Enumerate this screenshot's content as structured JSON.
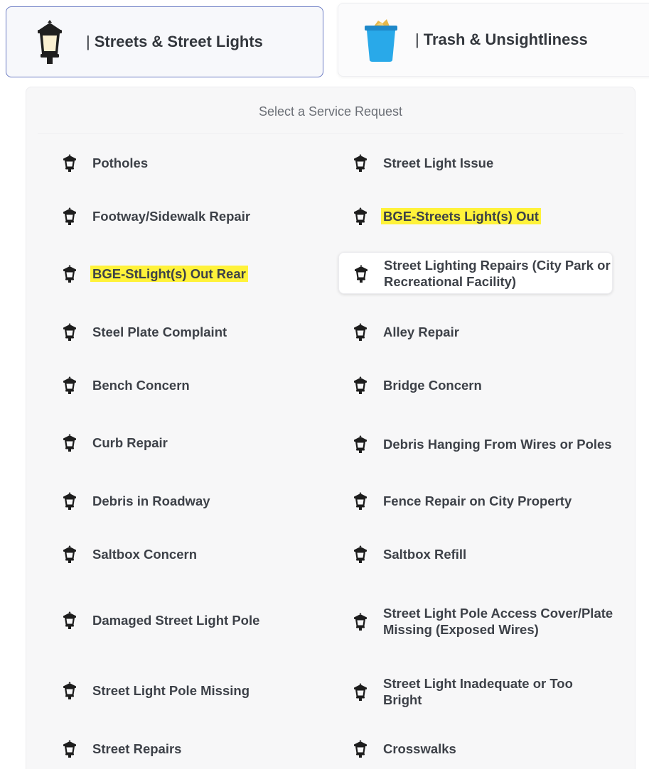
{
  "tabs": [
    {
      "label": "Streets & Street Lights",
      "icon": "street-lamp-icon",
      "selected": true
    },
    {
      "label": "Trash & Unsightliness",
      "icon": "trash-can-icon",
      "selected": false
    }
  ],
  "panel": {
    "title": "Select a Service Request",
    "items": [
      {
        "label": "Potholes",
        "highlighted": false
      },
      {
        "label": "Street Light Issue",
        "highlighted": false
      },
      {
        "label": "Footway/Sidewalk Repair",
        "highlighted": false
      },
      {
        "label": "BGE-Streets Light(s) Out",
        "highlighted": true
      },
      {
        "label": "BGE-StLight(s) Out Rear",
        "highlighted": true
      },
      {
        "label": "Street Lighting Repairs (City Park or Recreational Facility)",
        "highlighted": false
      },
      {
        "label": "Steel Plate Complaint",
        "highlighted": false
      },
      {
        "label": "Alley Repair",
        "highlighted": false
      },
      {
        "label": "Bench Concern",
        "highlighted": false
      },
      {
        "label": "Bridge Concern",
        "highlighted": false
      },
      {
        "label": "Curb Repair",
        "highlighted": false
      },
      {
        "label": "Debris Hanging From Wires or Poles",
        "highlighted": false
      },
      {
        "label": "Debris in Roadway",
        "highlighted": false
      },
      {
        "label": "Fence Repair on City Property",
        "highlighted": false
      },
      {
        "label": "Saltbox Concern",
        "highlighted": false
      },
      {
        "label": "Saltbox Refill",
        "highlighted": false
      },
      {
        "label": "Damaged Street Light Pole",
        "highlighted": false
      },
      {
        "label": "Street Light Pole Access Cover/Plate Missing (Exposed Wires)",
        "highlighted": false
      },
      {
        "label": "Street Light Pole Missing",
        "highlighted": false
      },
      {
        "label": "Street Light Inadequate or Too Bright",
        "highlighted": false
      },
      {
        "label": "Street Repairs",
        "highlighted": false
      },
      {
        "label": "Crosswalks",
        "highlighted": false
      }
    ],
    "item_icon": "street-lamp-icon",
    "highlight_color": "#fff23a",
    "accent_color": "#6c7cc4"
  }
}
